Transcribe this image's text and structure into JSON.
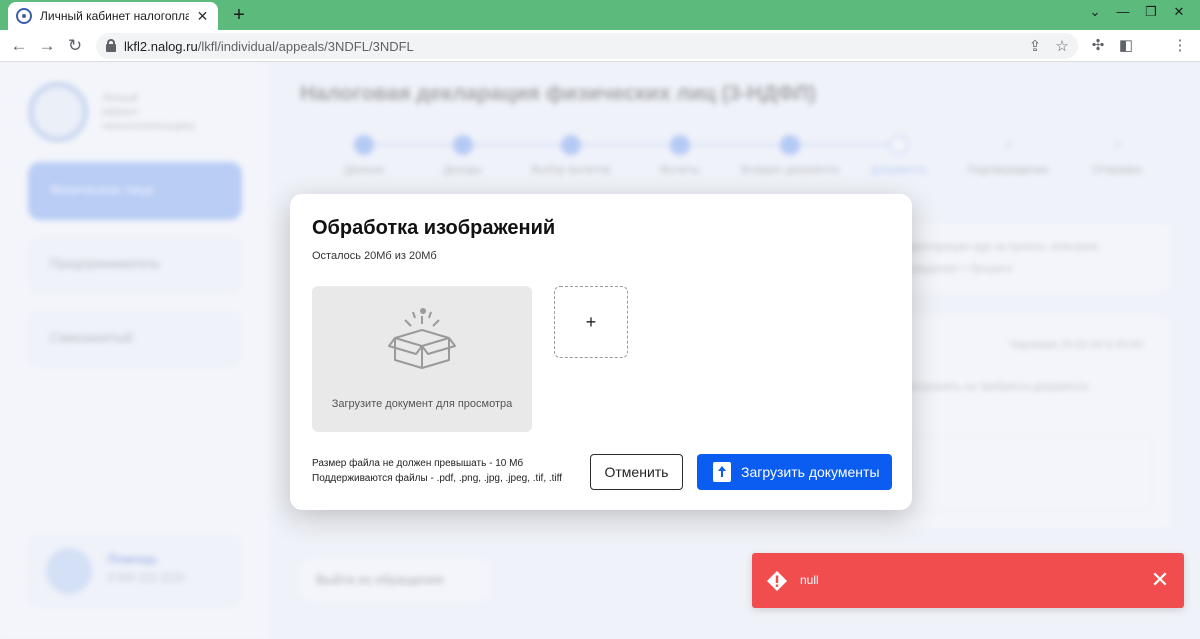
{
  "browser": {
    "tab_title": "Личный кабинет налогоплательщика",
    "close_tab": "✕",
    "new_tab": "+",
    "url_domain": "lkfl2.nalog.ru",
    "url_path": "/lkfl/individual/appeals/3NDFL/3NDFL",
    "window_controls": [
      "⌄",
      "—",
      "❐",
      "✕"
    ],
    "nav": [
      "←",
      "→",
      "↻"
    ]
  },
  "background": {
    "page_title": "Налоговая декларация физических лиц (3-НДФЛ)",
    "logo_text": [
      "Личный",
      "кабинет",
      "налогоплательщика"
    ],
    "sidebar": {
      "active_item": "Физическое лицо",
      "items": [
        "Предприниматель",
        "Самозанятый"
      ]
    },
    "help": {
      "title": "Помощь",
      "phone": "8 800 222 2222"
    },
    "steps": [
      "Данные",
      "Доходы",
      "Выбор вычетов",
      "Вычеты",
      "Возврат документа",
      "Документы",
      "Подтверждение",
      "Отправка"
    ],
    "info_text": [
      "декларации иди за пункты, описание",
      "сведения > Лучшего"
    ],
    "card_meta": "Черновик 20.02.00 в 20:00",
    "card_body": "сохранить не требуется документы",
    "back_button": "Выйти из обращения"
  },
  "modal": {
    "title": "Обработка изображений",
    "quota": "Осталось 20Мб из 20Мб",
    "dropzone_text": "Загрузите документ для просмотра",
    "add_tile": "+",
    "hint_size": "Размер файла не должен превышать - 10 Мб",
    "hint_formats": "Поддерживаются файлы - .pdf, .png, .jpg, .jpeg, .tif, .tiff",
    "cancel_label": "Отменить",
    "upload_label": "Загрузить документы"
  },
  "toast": {
    "message": "null",
    "close": "✕",
    "color": "#f14d4f"
  },
  "colors": {
    "chrome_green": "#5cba7d",
    "primary": "#0b5cf0"
  }
}
